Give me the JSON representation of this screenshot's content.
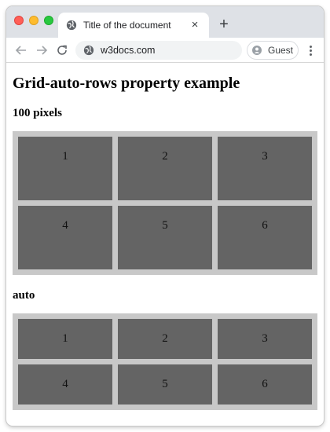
{
  "browser": {
    "tab_title": "Title of the document",
    "tab_close": "×",
    "new_tab": "+",
    "url": "w3docs.com",
    "profile_label": "Guest"
  },
  "page": {
    "heading": "Grid-auto-rows property example",
    "section_1": {
      "title": "100 pixels",
      "items": [
        "1",
        "2",
        "3",
        "4",
        "5",
        "6"
      ]
    },
    "section_2": {
      "title": "auto",
      "items": [
        "1",
        "2",
        "3",
        "4",
        "5",
        "6"
      ]
    }
  },
  "colors": {
    "grid_background": "#c8c8c8",
    "cell_background": "#646464"
  },
  "icons": {
    "back": "back-arrow-icon",
    "forward": "forward-arrow-icon",
    "reload": "reload-icon",
    "site": "globe-icon",
    "profile": "person-icon",
    "menu": "kebab-menu-icon"
  }
}
